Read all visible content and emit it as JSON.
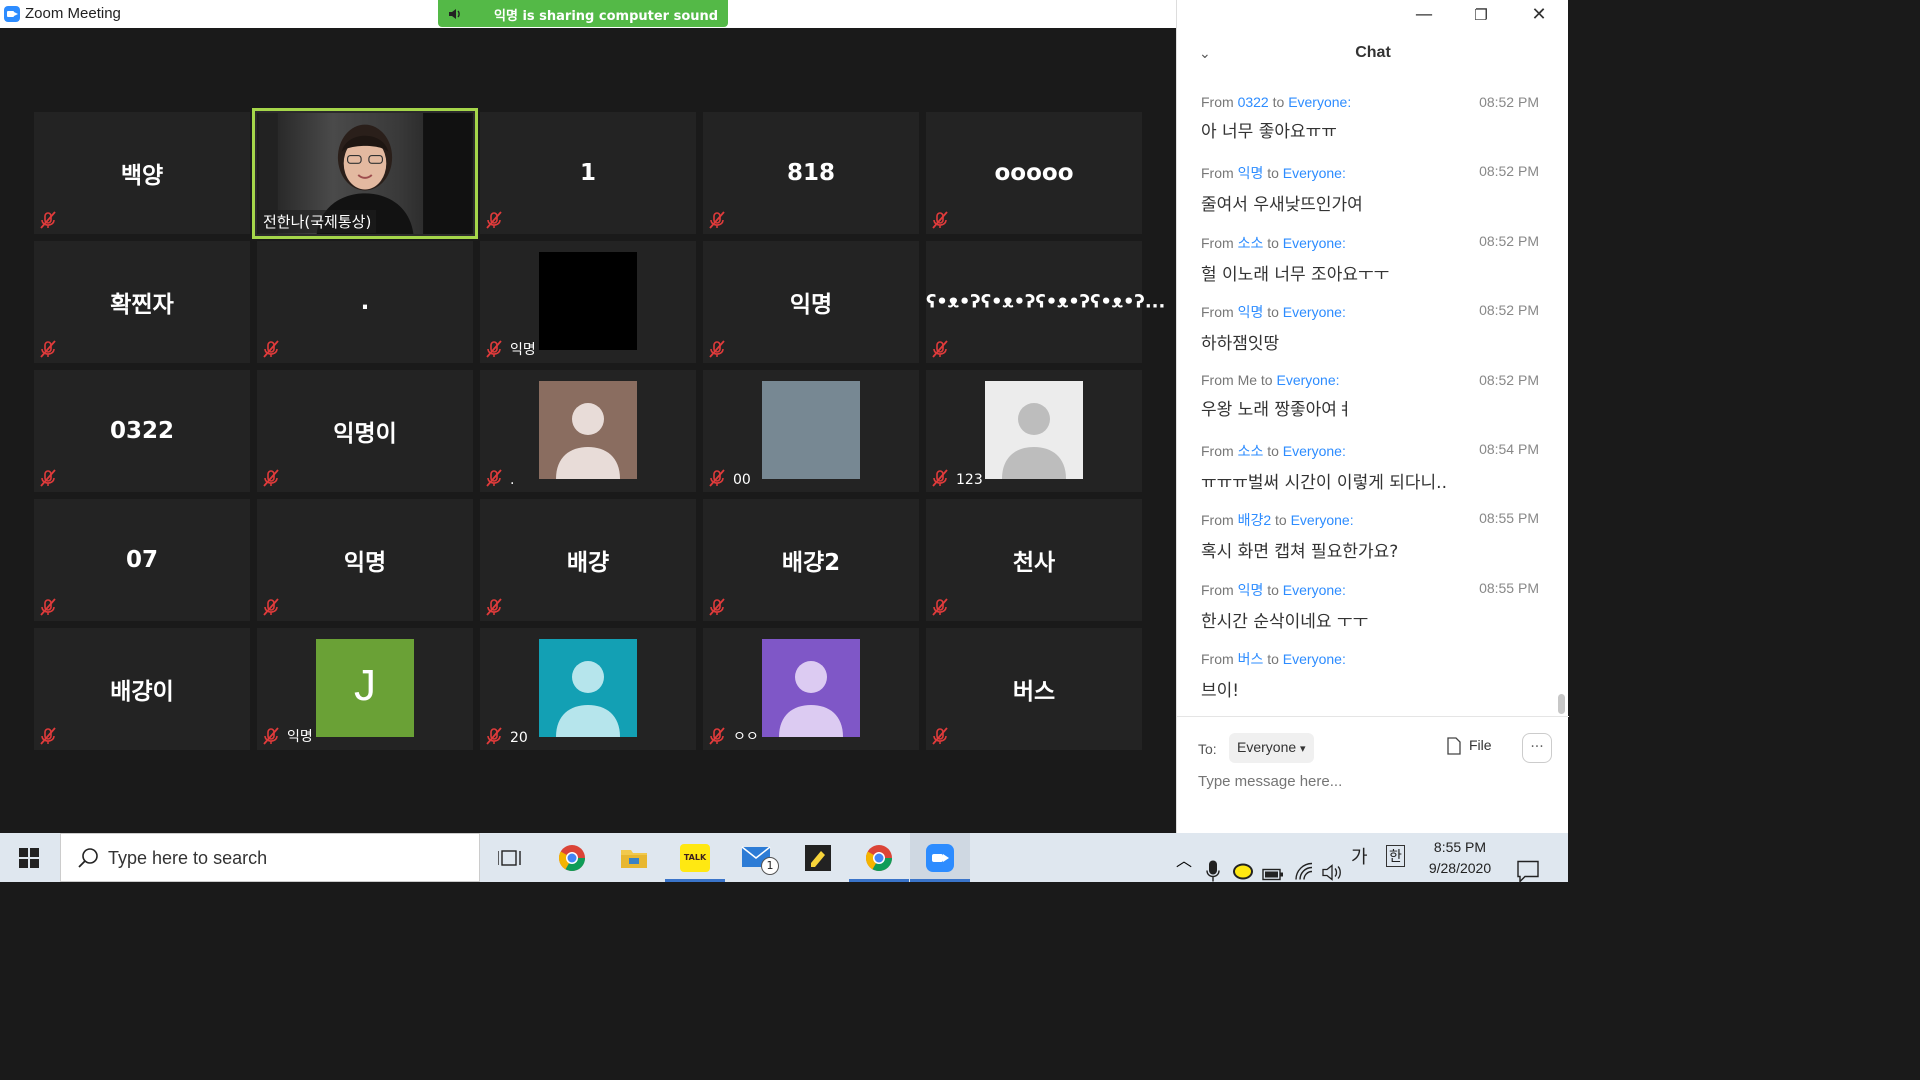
{
  "window": {
    "title": "Zoom Meeting",
    "share_banner": "익명 is sharing computer sound"
  },
  "tiles": [
    {
      "name": "백양",
      "label": ""
    },
    {
      "name": "",
      "label": "전한나(국제통상)",
      "video": true
    },
    {
      "name": "1",
      "label": ""
    },
    {
      "name": "818",
      "label": ""
    },
    {
      "name": "ooooo",
      "label": ""
    },
    {
      "name": "확찐자",
      "label": ""
    },
    {
      "name": ".",
      "label": ""
    },
    {
      "name": "",
      "label": "익명",
      "avatar": "black"
    },
    {
      "name": "익명",
      "label": ""
    },
    {
      "name": "ʕ•ᴥ•ʔʕ•ᴥ•ʔʕ•ᴥ•ʔʕ•ᴥ•ʔ...",
      "label": ""
    },
    {
      "name": "0322",
      "label": ""
    },
    {
      "name": "익명이",
      "label": ""
    },
    {
      "name": "",
      "label": ".",
      "avatar": "brown-person"
    },
    {
      "name": "",
      "label": "00",
      "avatar": "slate"
    },
    {
      "name": "",
      "label": "123",
      "avatar": "light-person"
    },
    {
      "name": "07",
      "label": ""
    },
    {
      "name": "익명",
      "label": ""
    },
    {
      "name": "배걍",
      "label": ""
    },
    {
      "name": "배걍2",
      "label": ""
    },
    {
      "name": "천사",
      "label": ""
    },
    {
      "name": "배걍이",
      "label": ""
    },
    {
      "name": "J",
      "label": "익명",
      "avatar": "green-initial"
    },
    {
      "name": "",
      "label": "20",
      "avatar": "teal-person"
    },
    {
      "name": "",
      "label": "ㅇㅇ",
      "avatar": "purple-person"
    },
    {
      "name": "버스",
      "label": ""
    }
  ],
  "chat": {
    "title": "Chat",
    "messages": [
      {
        "from": "0322",
        "to": "Everyone:",
        "time": "08:52 PM",
        "text": "아 너무 좋아요ㅠㅠ"
      },
      {
        "from": "익명",
        "to": "Everyone:",
        "time": "08:52 PM",
        "text": "줄여서 우새낮뜨인가여"
      },
      {
        "from": "소소",
        "to": "Everyone:",
        "time": "08:52 PM",
        "text": "헐 이노래 너무 조아요ㅜㅜ"
      },
      {
        "from": "익명",
        "to": "Everyone:",
        "time": "08:52 PM",
        "text": "하하잼잇땅"
      },
      {
        "from": "Me",
        "to": "Everyone:",
        "time": "08:52 PM",
        "text": "우왕 노래 짱좋아여ㅕ"
      },
      {
        "from": "소소",
        "to": "Everyone:",
        "time": "08:54 PM",
        "text": "ㅠㅠㅠ벌써 시간이 이렇게 되다니.."
      },
      {
        "from": "배걍2",
        "to": "Everyone:",
        "time": "08:55 PM",
        "text": "혹시 화면 캡쳐 필요한가요?"
      },
      {
        "from": "익명",
        "to": "Everyone:",
        "time": "08:55 PM",
        "text": "한시간 순삭이네요 ㅜㅜ"
      },
      {
        "from": "버스",
        "to": "Everyone:",
        "time": "",
        "text": "브이!"
      }
    ],
    "from_prefix": "From",
    "to_word": "to",
    "compose": {
      "to_label": "To:",
      "recipient": "Everyone",
      "file_label": "File",
      "more_label": "···",
      "placeholder": "Type message here..."
    }
  },
  "taskbar": {
    "search_placeholder": "Type here to search",
    "clock_time": "8:55 PM",
    "clock_date": "9/28/2020",
    "ime_lang": "가",
    "ime_mode": "한",
    "mail_badge": "1"
  }
}
